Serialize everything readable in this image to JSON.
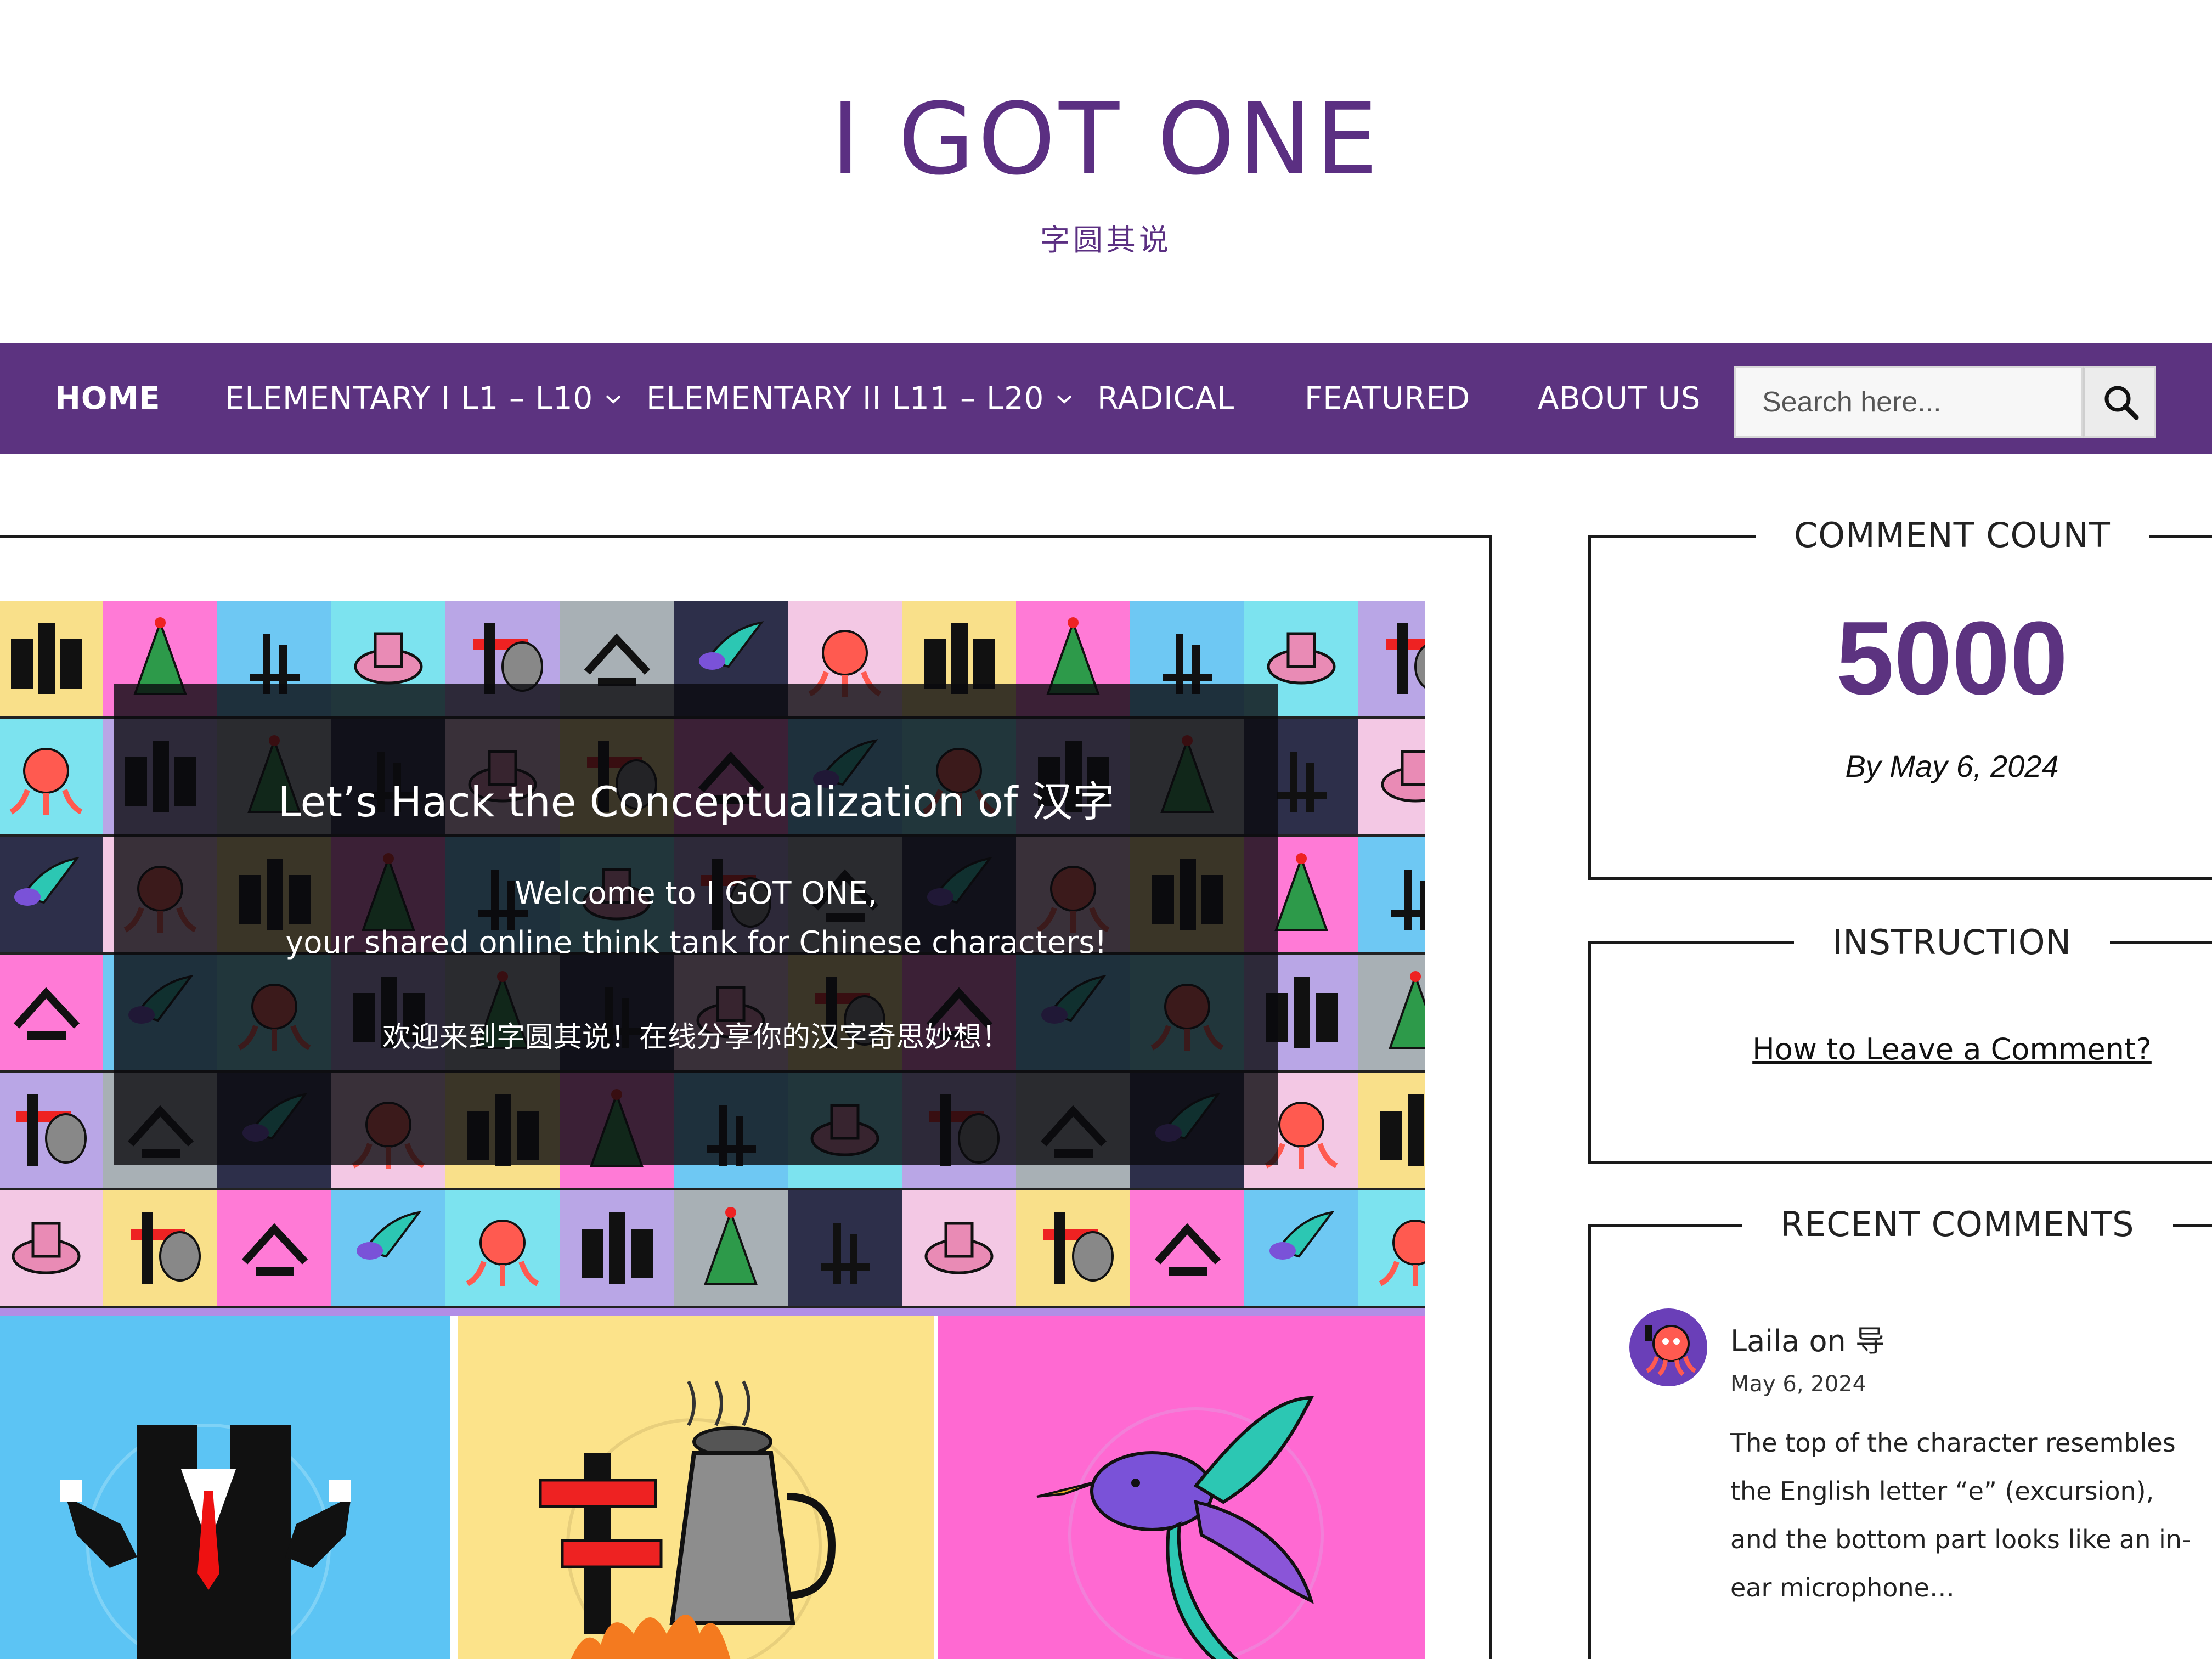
{
  "header": {
    "site_title": "I GOT ONE",
    "tagline": "字圆其说"
  },
  "nav": {
    "items": [
      {
        "label": "HOME",
        "active": true,
        "has_dropdown": false
      },
      {
        "label": "ELEMENTARY I L1 – L10",
        "active": false,
        "has_dropdown": true
      },
      {
        "label": "ELEMENTARY II L11 – L20",
        "active": false,
        "has_dropdown": true
      },
      {
        "label": "RADICAL",
        "active": false,
        "has_dropdown": false
      },
      {
        "label": "FEATURED",
        "active": false,
        "has_dropdown": false
      },
      {
        "label": "ABOUT US",
        "active": false,
        "has_dropdown": false
      }
    ],
    "search_placeholder": "Search here...",
    "search_icon": "magnifier-icon"
  },
  "hero": {
    "title": "Let’s Hack the Conceptualization of 汉字",
    "welcome_line1": "Welcome to I GOT ONE,",
    "welcome_line2": "your shared online think tank for Chinese characters!",
    "welcome_zh": "欢迎来到字圆其说！在线分享你的汉字奇思妙想！"
  },
  "cards": [
    {
      "icon": "tuxedo-character-illustration"
    },
    {
      "icon": "kettle-character-illustration"
    },
    {
      "icon": "bird-character-illustration"
    }
  ],
  "sidebar": {
    "comment_count": {
      "title": "COMMENT COUNT",
      "value": "5000",
      "date": "By May 6, 2024"
    },
    "instruction": {
      "title": "INSTRUCTION",
      "link": "How to Leave a Comment?"
    },
    "recent_comments": {
      "title": "RECENT COMMENTS",
      "items": [
        {
          "author_line": "Laila on 导",
          "date": "May 6, 2024",
          "text": "The top of the character resembles the English letter “e” (excursion), and the bottom part looks like an in-ear microphone…",
          "avatar_icon": "octopus-avatar-icon"
        }
      ]
    }
  },
  "colors": {
    "brand_purple": "#5c3380",
    "nav_text": "#ffffff",
    "count_value": "#5c3380"
  }
}
